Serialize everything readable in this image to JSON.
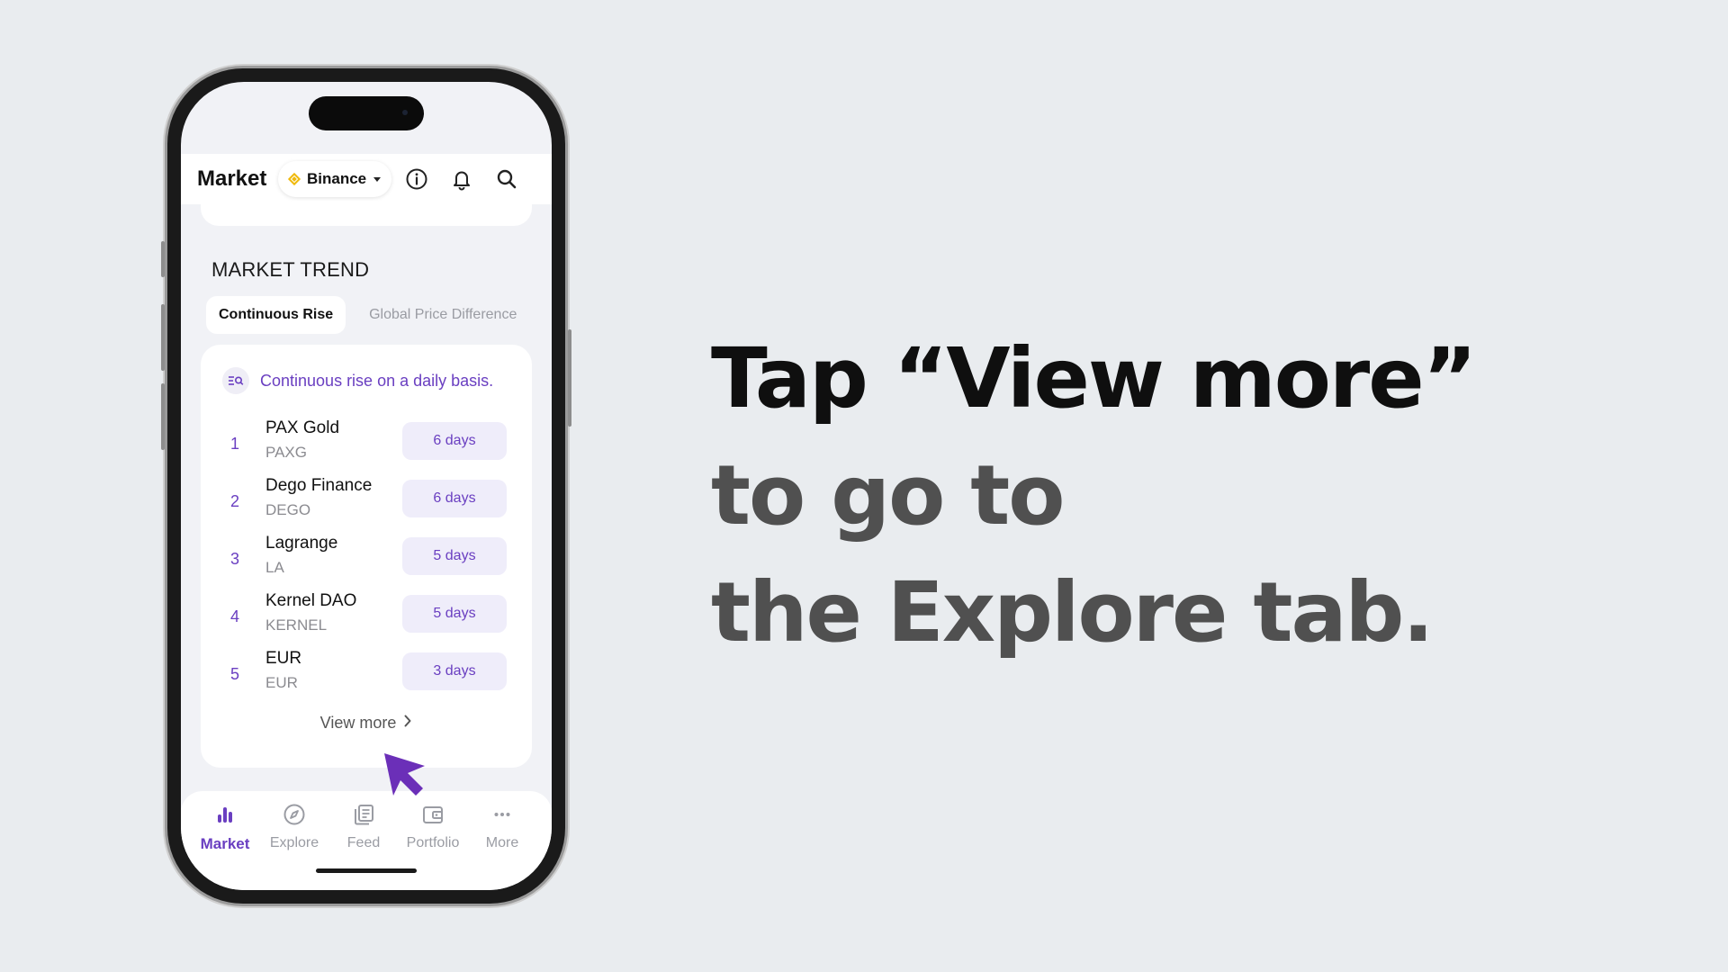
{
  "header": {
    "title": "Market",
    "exchange": "Binance"
  },
  "section": {
    "title": "MARKET TREND",
    "tabs": [
      {
        "label": "Continuous Rise"
      },
      {
        "label": "Global Price Difference"
      }
    ]
  },
  "trend": {
    "hint": "Continuous rise on a daily basis.",
    "rows": [
      {
        "rank": "1",
        "name": "PAX Gold",
        "symbol": "PAXG",
        "days": "6 days"
      },
      {
        "rank": "2",
        "name": "Dego Finance",
        "symbol": "DEGO",
        "days": "6 days"
      },
      {
        "rank": "3",
        "name": "Lagrange",
        "symbol": "LA",
        "days": "5 days"
      },
      {
        "rank": "4",
        "name": "Kernel DAO",
        "symbol": "KERNEL",
        "days": "5 days"
      },
      {
        "rank": "5",
        "name": "EUR",
        "symbol": "EUR",
        "days": "3 days"
      }
    ],
    "view_more": "View more"
  },
  "nav": {
    "items": [
      {
        "label": "Market"
      },
      {
        "label": "Explore"
      },
      {
        "label": "Feed"
      },
      {
        "label": "Portfolio"
      },
      {
        "label": "More"
      }
    ]
  },
  "caption": {
    "line1": "Tap “View more”",
    "line2": "to go to",
    "line3": "the Explore tab."
  },
  "colors": {
    "accent": "#6a3fc1",
    "background": "#e9ecef",
    "cursor": "#6b2fb8",
    "binance": "#f0b90b"
  },
  "icons": [
    "info-icon",
    "bell-icon",
    "search-icon",
    "chart-bars-icon",
    "compass-icon",
    "feed-icon",
    "wallet-icon",
    "more-dots-icon",
    "cursor-arrow-icon"
  ]
}
